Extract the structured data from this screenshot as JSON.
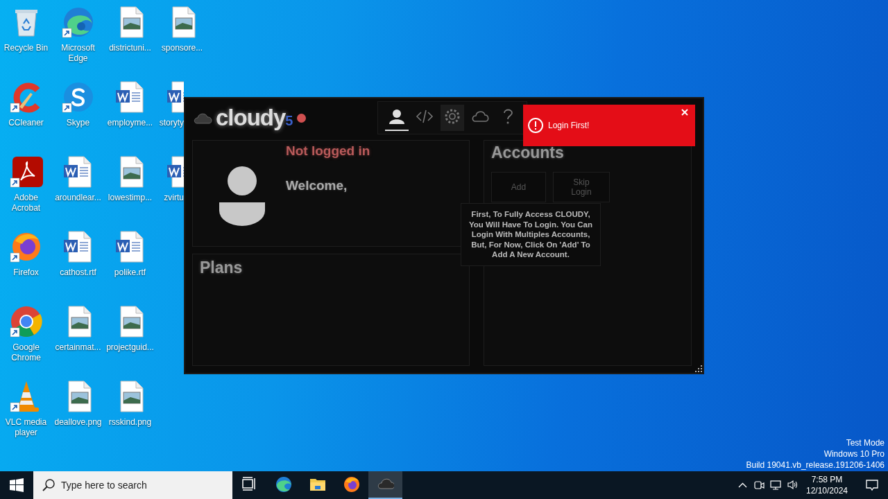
{
  "desktop": {
    "columns": [
      [
        {
          "label": "Recycle Bin",
          "kind": "recycle",
          "shortcut": false
        },
        {
          "label": "CCleaner",
          "kind": "ccleaner",
          "shortcut": true
        },
        {
          "label": "Adobe Acrobat",
          "kind": "acrobat",
          "shortcut": true
        },
        {
          "label": "Firefox",
          "kind": "firefox",
          "shortcut": true
        },
        {
          "label": "Google Chrome",
          "kind": "chrome",
          "shortcut": true
        },
        {
          "label": "VLC media player",
          "kind": "vlc",
          "shortcut": true
        }
      ],
      [
        {
          "label": "Microsoft Edge",
          "kind": "edge",
          "shortcut": true
        },
        {
          "label": "Skype",
          "kind": "skype",
          "shortcut": true
        },
        {
          "label": "aroundlear...",
          "kind": "word",
          "shortcut": false
        },
        {
          "label": "cathost.rtf",
          "kind": "word",
          "shortcut": false
        },
        {
          "label": "certainmat...",
          "kind": "image",
          "shortcut": false
        },
        {
          "label": "deallove.png",
          "kind": "image",
          "shortcut": false
        }
      ],
      [
        {
          "label": "districtuni...",
          "kind": "image",
          "shortcut": false
        },
        {
          "label": "employme...",
          "kind": "word",
          "shortcut": false
        },
        {
          "label": "lowestimp...",
          "kind": "image",
          "shortcut": false
        },
        {
          "label": "polike.rtf",
          "kind": "word",
          "shortcut": false
        },
        {
          "label": "projectguid...",
          "kind": "image",
          "shortcut": false
        },
        {
          "label": "rsskind.png",
          "kind": "image",
          "shortcut": false
        }
      ],
      [
        {
          "label": "sponsore...",
          "kind": "image",
          "shortcut": false
        },
        {
          "label": "storyty",
          "kind": "word",
          "shortcut": false,
          "partly_hidden": true
        },
        {
          "label": "zvirtu",
          "kind": "word",
          "shortcut": false,
          "partly_hidden": true
        }
      ]
    ]
  },
  "system_info": [
    "Test Mode",
    "Windows 10 Pro",
    "Build 19041.vb_release.191206-1406"
  ],
  "app": {
    "logo": {
      "name": "cloudy",
      "version": "5"
    },
    "nav": [
      {
        "kind": "user",
        "selected": true,
        "hovered": false
      },
      {
        "kind": "code",
        "selected": false,
        "hovered": false
      },
      {
        "kind": "settings",
        "selected": false,
        "hovered": true
      },
      {
        "kind": "cloud",
        "selected": false,
        "hovered": false
      },
      {
        "kind": "help",
        "selected": false,
        "hovered": false
      }
    ],
    "toast": {
      "message": "Login First!"
    },
    "profile": {
      "status": "Not logged in",
      "greeting": "Welcome,"
    },
    "plans": {
      "title": "Plans"
    },
    "accounts": {
      "title": "Accounts",
      "buttons": [
        "Add",
        "Skip Login"
      ]
    },
    "tooltip": "First, To Fully Access CLOUDY, You Will Have To Login. You Can Login With Multiples Accounts, But, For Now, Click On 'Add' To Add A New Account."
  },
  "taskbar": {
    "search": {
      "placeholder": "Type here to search"
    },
    "apps": [
      {
        "kind": "taskview",
        "active": false
      },
      {
        "kind": "edge",
        "active": false
      },
      {
        "kind": "explorer",
        "active": false
      },
      {
        "kind": "firefox",
        "active": false
      },
      {
        "kind": "cloudy",
        "active": true
      }
    ],
    "time": "7:58 PM",
    "date": "12/10/2024"
  }
}
